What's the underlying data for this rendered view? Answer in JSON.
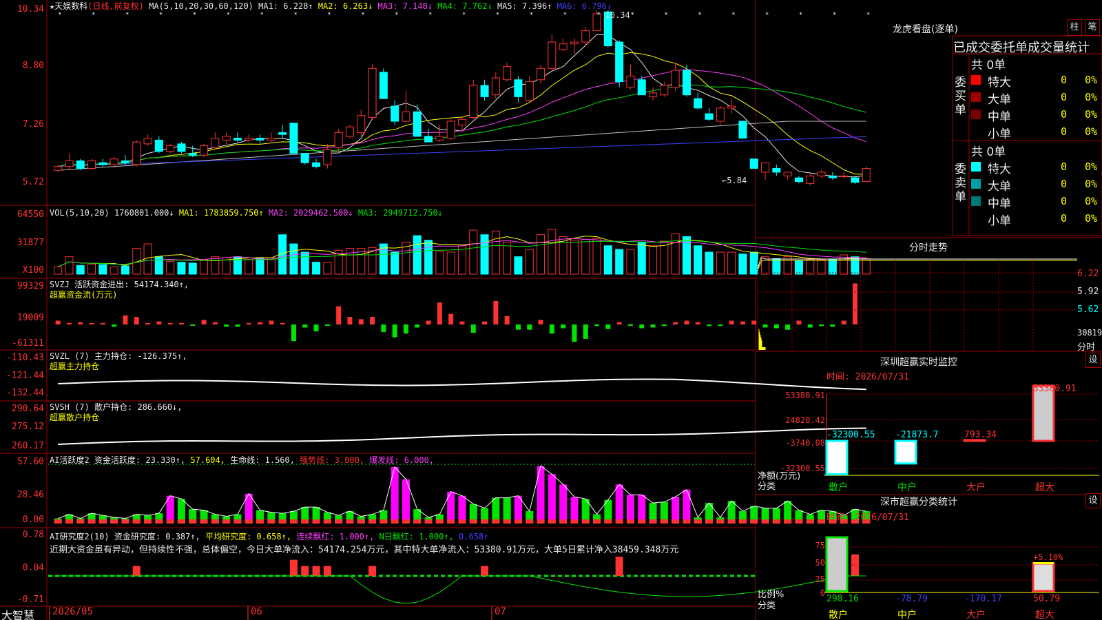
{
  "title": "天娱数科",
  "title_mode": "(日线,前复权)",
  "title_star": "★",
  "ma_line": {
    "label": "MA(5,10,20,30,60,120)",
    "items": [
      {
        "t": "MA1: 6.228↑",
        "c": "white"
      },
      {
        "t": "MA2: 6.263↓",
        "c": "yellow"
      },
      {
        "t": "MA3: 7.148↓",
        "c": "magenta"
      },
      {
        "t": "MA4: 7.762↓",
        "c": "green"
      },
      {
        "t": "MA5: 7.396↑",
        "c": "white"
      },
      {
        "t": "MA6: 6.796↓",
        "c": "blue"
      }
    ]
  },
  "price_axis": [
    "10.34",
    "8.80",
    "7.26",
    "5.72"
  ],
  "price_hi": "10.34",
  "price_lo": "←5.84",
  "vol_line": {
    "label": "VOL(5,10,20)",
    "items": [
      {
        "t": "1760801.000↓",
        "c": "white"
      },
      {
        "t": "MA1: 1783859.750↑",
        "c": "yellow"
      },
      {
        "t": "MA2: 2029462.500↓",
        "c": "magenta"
      },
      {
        "t": "MA3: 2949712.750↓",
        "c": "green"
      }
    ]
  },
  "vol_axis": [
    "64550",
    "31877",
    "X100"
  ],
  "svzj": {
    "name": "SVZJ",
    "label": "活跃资金进出: 54174.340↑,",
    "sub": "超赢资金流(万元)",
    "axis": [
      "99329",
      "19009",
      "-61311"
    ]
  },
  "svzl": {
    "name": "SVZL  (7)",
    "label": "主力持仓: -126.375↑,",
    "sub": "超赢主力持仓",
    "axis": [
      "-110.43",
      "-121.44",
      "-132.44"
    ]
  },
  "svsh": {
    "name": "SVSH  (7)",
    "label": "散户持仓: 286.660↓,",
    "sub": "超赢散户持仓",
    "axis": [
      "290.64",
      "275.12",
      "260.17"
    ]
  },
  "ai2": {
    "items": [
      {
        "t": "AI活跃度2",
        "c": "white"
      },
      {
        "t": "资金活跃度: 23.330↑,",
        "c": "white"
      },
      {
        "t": "57.604,",
        "c": "yellow"
      },
      {
        "t": "生命线: 1.560,",
        "c": "white"
      },
      {
        "t": "强势线: 3.000,",
        "c": "red"
      },
      {
        "t": "爆发线: 6.000,",
        "c": "magenta"
      }
    ],
    "axis": [
      "57.60",
      "28.46",
      "0.00"
    ]
  },
  "ai_research": {
    "items": [
      {
        "t": "AI研究度2(10)",
        "c": "white"
      },
      {
        "t": "资金研究度: 0.387↑,",
        "c": "white"
      },
      {
        "t": "平均研究度: 0.658↑,",
        "c": "yellow"
      },
      {
        "t": "连续飘红: 1.000↑,",
        "c": "magenta"
      },
      {
        "t": "N日飘红: 1.000↑,",
        "c": "green"
      },
      {
        "t": "0.658↑",
        "c": "blue"
      }
    ],
    "comment": "近期大资金虽有异动，但持续性不强，总体偏空，今日大单净流入：54174.254万元，其中特大单净流入：53380.91万元，大单5日累计净入38459.348万元",
    "axis": [
      "0.78",
      "0.04",
      "-0.71"
    ]
  },
  "date_axis": [
    "2026/05",
    "06",
    "07"
  ],
  "brand": "大智慧",
  "right": {
    "lhb_title": "龙虎看盘(逐单)",
    "btn1": "柱",
    "btn2": "笔",
    "tabs": "已成交委托单成交量统计",
    "buy": {
      "label": "委买单",
      "total": "共 0单",
      "rows": [
        {
          "name": "特大",
          "count": "0",
          "pct": "0%",
          "color": "#ff0000"
        },
        {
          "name": "大单",
          "count": "0",
          "pct": "0%",
          "color": "#a00000"
        },
        {
          "name": "中单",
          "count": "0",
          "pct": "0%",
          "color": "#780000"
        },
        {
          "name": "小单",
          "count": "0",
          "pct": "0%",
          "color": ""
        }
      ]
    },
    "sell": {
      "label": "委卖单",
      "total": "共 0单",
      "rows": [
        {
          "name": "特大",
          "count": "0",
          "pct": "0%",
          "color": "#00ffff"
        },
        {
          "name": "大单",
          "count": "0",
          "pct": "0%",
          "color": "#00a0a0"
        },
        {
          "name": "中单",
          "count": "0",
          "pct": "0%",
          "color": "#007878"
        },
        {
          "name": "小单",
          "count": "0",
          "pct": "0%",
          "color": ""
        }
      ]
    },
    "fs_title": "分时走势",
    "fs_axis": [
      "6.22",
      "5.92",
      "5.62",
      "30819",
      "分时"
    ],
    "sz_title": "深圳超赢实时监控",
    "sz_set": "设",
    "sz_time": "时间: 2026/07/31",
    "sz_axis": [
      "53380.91",
      "24820.42",
      "-3740.08",
      "-32300.55"
    ],
    "sz_vals": [
      "-32300.55",
      "-21873.7",
      "793.34",
      "53380.91"
    ],
    "sz_ylab": "净额(万元)",
    "sz_xlab": "分类",
    "cats": [
      "散户",
      "中户",
      "大户",
      "超大"
    ],
    "fl_title": "深市超赢分类统计",
    "fl_set": "设",
    "fl_time": "时间: 2026/07/31",
    "fl_axis": [
      "75",
      "50",
      "25",
      "0"
    ],
    "fl_vals": [
      "298.16",
      "-78.79",
      "-170.17",
      "50.79"
    ],
    "fl_pct": "+5.10%",
    "fl_ylab": "比例%",
    "fl_xlab": "分类"
  },
  "chart_data": {
    "type": "candlestick",
    "title": "天娱数科 (日线,前复权)",
    "ylim": [
      5.72,
      10.34
    ],
    "ohlc": [
      [
        6.1,
        6.25,
        6.05,
        6.2
      ],
      [
        6.2,
        6.55,
        6.1,
        6.35
      ],
      [
        6.35,
        6.4,
        6.1,
        6.15
      ],
      [
        6.15,
        6.4,
        6.1,
        6.35
      ],
      [
        6.3,
        6.4,
        6.2,
        6.25
      ],
      [
        6.25,
        6.45,
        6.15,
        6.4
      ],
      [
        6.35,
        6.5,
        6.25,
        6.3
      ],
      [
        6.25,
        6.9,
        6.2,
        6.85
      ],
      [
        6.8,
        7.05,
        6.75,
        6.95
      ],
      [
        6.9,
        7.0,
        6.55,
        6.6
      ],
      [
        6.6,
        6.8,
        6.55,
        6.75
      ],
      [
        6.8,
        6.85,
        6.55,
        6.6
      ],
      [
        6.55,
        6.75,
        6.45,
        6.5
      ],
      [
        6.5,
        6.8,
        6.45,
        6.75
      ],
      [
        6.7,
        7.1,
        6.65,
        6.95
      ],
      [
        6.9,
        7.1,
        6.8,
        7.0
      ],
      [
        6.95,
        7.1,
        6.85,
        6.9
      ],
      [
        6.9,
        7.05,
        6.85,
        6.95
      ],
      [
        6.95,
        7.05,
        6.8,
        6.9
      ],
      [
        6.9,
        7.1,
        6.85,
        6.95
      ],
      [
        7.1,
        7.3,
        6.95,
        7.05
      ],
      [
        7.35,
        7.35,
        6.55,
        6.55
      ],
      [
        6.55,
        6.55,
        6.25,
        6.3
      ],
      [
        6.3,
        6.4,
        6.15,
        6.2
      ],
      [
        6.25,
        6.8,
        6.15,
        6.65
      ],
      [
        6.7,
        7.2,
        6.6,
        7.1
      ],
      [
        7.0,
        7.3,
        6.95,
        7.25
      ],
      [
        7.1,
        7.7,
        7.0,
        7.55
      ],
      [
        7.5,
        8.9,
        7.45,
        8.8
      ],
      [
        8.7,
        8.8,
        8.0,
        8.0
      ],
      [
        7.8,
        7.95,
        7.3,
        7.4
      ],
      [
        7.4,
        8.2,
        7.35,
        7.65
      ],
      [
        7.65,
        7.85,
        7.05,
        7.0
      ],
      [
        7.0,
        7.2,
        6.85,
        6.85
      ],
      [
        6.9,
        7.3,
        6.85,
        7.0
      ],
      [
        6.95,
        7.45,
        6.9,
        7.4
      ],
      [
        7.3,
        7.5,
        7.15,
        7.45
      ],
      [
        7.5,
        8.5,
        7.45,
        8.35
      ],
      [
        8.35,
        8.5,
        7.95,
        8.05
      ],
      [
        8.1,
        8.7,
        8.0,
        8.55
      ],
      [
        8.5,
        8.95,
        8.45,
        8.85
      ],
      [
        8.5,
        8.6,
        7.9,
        8.05
      ],
      [
        7.95,
        8.6,
        7.9,
        8.45
      ],
      [
        8.5,
        8.9,
        8.4,
        8.8
      ],
      [
        8.8,
        9.7,
        8.75,
        9.5
      ],
      [
        9.3,
        9.6,
        9.25,
        9.45
      ],
      [
        9.45,
        9.6,
        9.2,
        9.5
      ],
      [
        9.5,
        9.9,
        9.4,
        9.8
      ],
      [
        9.8,
        10.34,
        9.8,
        10.25
      ],
      [
        10.3,
        10.34,
        9.35,
        9.4
      ],
      [
        9.5,
        9.55,
        8.3,
        8.45
      ],
      [
        8.3,
        8.9,
        8.25,
        8.6
      ],
      [
        8.5,
        8.6,
        8.1,
        8.1
      ],
      [
        8.05,
        8.3,
        7.95,
        8.15
      ],
      [
        8.1,
        8.45,
        8.05,
        8.35
      ],
      [
        8.3,
        8.95,
        8.2,
        8.75
      ],
      [
        8.75,
        8.9,
        8.05,
        8.1
      ],
      [
        8.0,
        8.15,
        7.7,
        7.75
      ],
      [
        7.6,
        7.75,
        7.4,
        7.45
      ],
      [
        7.4,
        7.8,
        7.3,
        7.75
      ],
      [
        7.75,
        8.0,
        7.6,
        7.8
      ],
      [
        7.4,
        7.4,
        6.95,
        6.95
      ],
      [
        6.4,
        6.4,
        6.15,
        6.15
      ],
      [
        6.05,
        6.2,
        5.84,
        6.3
      ],
      [
        6.15,
        6.25,
        5.95,
        6.05
      ],
      [
        5.95,
        6.05,
        5.85,
        6.05
      ],
      [
        5.9,
        5.95,
        5.75,
        5.8
      ],
      [
        5.75,
        6.0,
        5.7,
        5.95
      ],
      [
        5.95,
        6.1,
        5.9,
        6.05
      ],
      [
        5.95,
        6.05,
        5.85,
        5.9
      ],
      [
        5.95,
        6.05,
        5.88,
        5.95
      ],
      [
        5.9,
        5.95,
        5.74,
        5.78
      ],
      [
        5.8,
        6.2,
        5.78,
        6.15
      ]
    ],
    "volume": [
      8000,
      19000,
      9500,
      11000,
      10500,
      8000,
      9000,
      28000,
      33000,
      19000,
      14000,
      13000,
      12000,
      16000,
      19000,
      18000,
      19000,
      16000,
      18000,
      18000,
      43000,
      33000,
      24000,
      13000,
      13000,
      26000,
      28000,
      28000,
      29000,
      33000,
      24000,
      35000,
      42000,
      37000,
      25000,
      24000,
      31000,
      48000,
      43000,
      47000,
      35000,
      19000,
      27000,
      43000,
      49000,
      41000,
      37000,
      38000,
      39000,
      31000,
      27000,
      27000,
      35000,
      31000,
      36000,
      44000,
      41000,
      31000,
      24000,
      24000,
      24000,
      22000,
      24000,
      19000,
      17000,
      19000,
      15000,
      16000,
      16000,
      16000,
      21000,
      19000,
      17000,
      19000,
      18000,
      19000
    ],
    "svzj": [
      5000,
      2000,
      3000,
      2000,
      2000,
      -3000,
      12000,
      10000,
      2000,
      4000,
      2000,
      2000,
      -1000,
      6000,
      3000,
      -3000,
      -3000,
      2000,
      3000,
      5000,
      2000,
      -22000,
      -4000,
      -9000,
      -1000,
      24000,
      10000,
      7000,
      10000,
      -10000,
      -17000,
      -12000,
      -4000,
      5000,
      29000,
      14000,
      4000,
      -11000,
      4000,
      31000,
      11000,
      -7000,
      -7000,
      6000,
      -12000,
      -5000,
      -23000,
      -19000,
      -2000,
      -6000,
      3000,
      -1000,
      -5000,
      -4000,
      -2000,
      3000,
      5000,
      3000,
      -2000,
      -1000,
      5000,
      4000,
      5000,
      -4000,
      -5000,
      -7000,
      5000,
      -4000,
      -2000,
      -3000,
      5000,
      54174
    ],
    "ai2": [
      5,
      9,
      5,
      10,
      8,
      6,
      5,
      9,
      8,
      10,
      27,
      24,
      14,
      13,
      9,
      7,
      9,
      29,
      13,
      11,
      10,
      12,
      16,
      16,
      11,
      8,
      12,
      7,
      9,
      13,
      55,
      43,
      14,
      6,
      9,
      31,
      27,
      19,
      15,
      25,
      25,
      27,
      12,
      56,
      48,
      38,
      26,
      24,
      9,
      23,
      38,
      28,
      28,
      20,
      21,
      26,
      33,
      6,
      20,
      6,
      22,
      12,
      17,
      15,
      15,
      22,
      13,
      9,
      13,
      12,
      8,
      14,
      12,
      11,
      10,
      16,
      23
    ],
    "ai_research": [
      0.04,
      0.04,
      0.04,
      0.04,
      0.04,
      0.04,
      0.04,
      0.2,
      0.04,
      0.04,
      0.04,
      0.04,
      0.04,
      0.04,
      0.04,
      0.04,
      0.04,
      0.04,
      0.04,
      0.04,
      0.04,
      0.3,
      0.2,
      0.2,
      0.2,
      0.04,
      0.04,
      0.04,
      0.2,
      0.04,
      0.04,
      0.04,
      0.04,
      0.04,
      0.04,
      0.04,
      0.04,
      0.04,
      0.2,
      0.04,
      0.04,
      0.04,
      0.04,
      0.04,
      0.04,
      0.04,
      0.04,
      0.04,
      0.04,
      0.04,
      0.35,
      0.04,
      0.04,
      0.04,
      0.04,
      0.04,
      0.04,
      0.04,
      0.04,
      0.04,
      0.04,
      0.04,
      0.04,
      0.04,
      0.04,
      0.04,
      0.04,
      0.04,
      0.04,
      0.04,
      0.04,
      0.387
    ],
    "sz_net": [
      {
        "cat": "散户",
        "value": -32300.55
      },
      {
        "cat": "中户",
        "value": -21873.7
      },
      {
        "cat": "大户",
        "value": 793.34
      },
      {
        "cat": "超大",
        "value": 53380.91
      }
    ],
    "sz_ratio": [
      {
        "cat": "散户",
        "value": 298.16
      },
      {
        "cat": "中户",
        "value": -78.79
      },
      {
        "cat": "大户",
        "value": -170.17
      },
      {
        "cat": "超大",
        "value": 50.79
      }
    ]
  }
}
